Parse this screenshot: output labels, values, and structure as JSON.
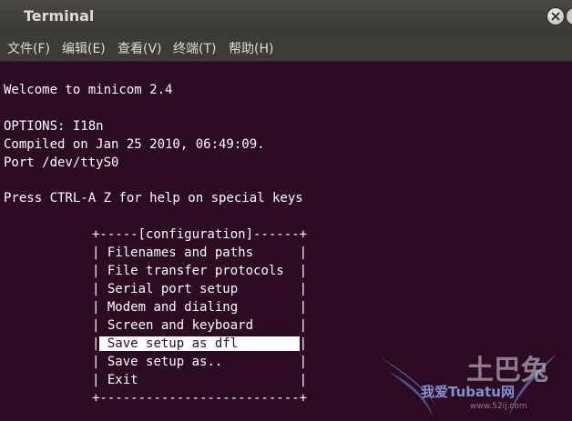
{
  "window": {
    "title": "Terminal"
  },
  "menu": [
    {
      "label": "文件(F)"
    },
    {
      "label": "编辑(E)"
    },
    {
      "label": "查看(V)"
    },
    {
      "label": "终端(T)"
    },
    {
      "label": "帮助(H)"
    }
  ],
  "terminal": {
    "lines": [
      "Welcome to minicom 2.4",
      "OPTIONS: I18n",
      "Compiled on Jan 25 2010, 06:49:09.",
      "Port /dev/ttyS0",
      "Press CTRL-A Z for help on special keys"
    ],
    "config_menu": {
      "top_border": "+-----[configuration]------+",
      "items": [
        "Filenames and paths",
        "File transfer protocols",
        "Serial port setup",
        "Modem and dialing",
        "Screen and keyboard",
        "Save setup as dfl",
        "Save setup as..",
        "Exit"
      ],
      "selected_index": 5,
      "bottom_border": "+--------------------------+"
    }
  },
  "watermark": {
    "big": "土巴兔",
    "small": "我爱Tubatu网",
    "url": "www.52ij.com"
  },
  "colors": {
    "terminal_bg": "#2c0a22",
    "titlebar": "#3c3b37",
    "text": "#ffffff"
  }
}
